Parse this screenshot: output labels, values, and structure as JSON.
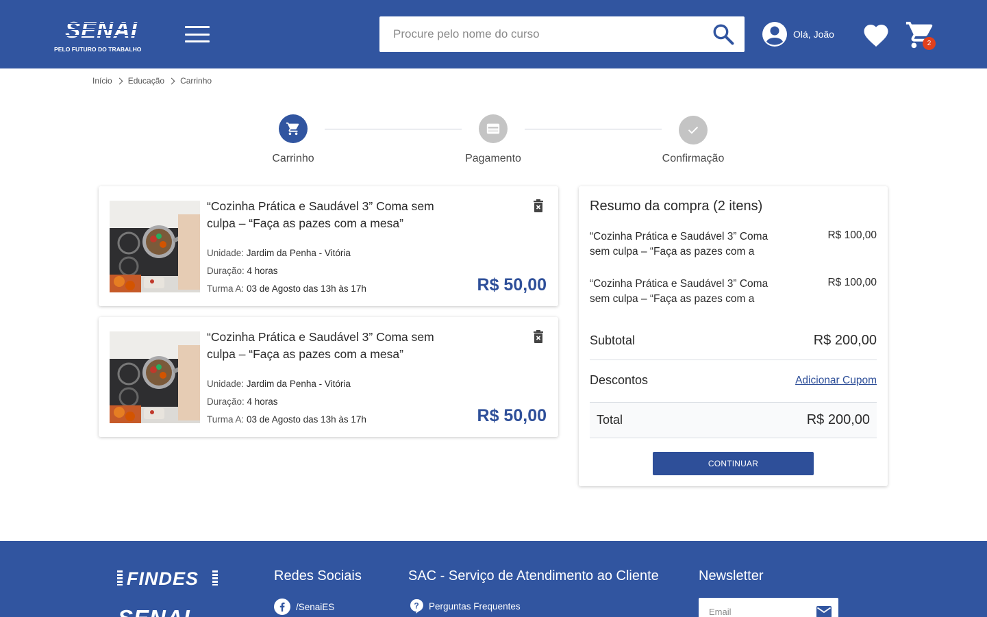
{
  "header": {
    "logo_text": "SENAI",
    "logo_tagline": "PELO FUTURO DO TRABALHO",
    "search_placeholder": "Procure pelo nome do curso",
    "user_greeting": "Olá, João",
    "cart_count": "2"
  },
  "breadcrumb": [
    "Início",
    "Educação",
    "Carrinho"
  ],
  "steps": [
    {
      "label": "Carrinho",
      "state": "active",
      "icon": "cart-icon"
    },
    {
      "label": "Pagamento",
      "state": "pending",
      "icon": "credit-card-icon"
    },
    {
      "label": "Confirmação",
      "state": "pending",
      "icon": "check-icon"
    }
  ],
  "cart_items": [
    {
      "title": "“Cozinha Prática e Saudável 3” Coma sem culpa – “Faça as pazes com a mesa”",
      "unit_label": "Unidade: ",
      "unit_value": "Jardim da Penha - Vitória",
      "duration_label": "Duração: ",
      "duration_value": "4 horas",
      "class_label": "Turma A: ",
      "class_value": "03 de Agosto das 13h às 17h",
      "price": "R$ 50,00"
    },
    {
      "title": "“Cozinha Prática e Saudável 3” Coma sem culpa – “Faça as pazes com a mesa”",
      "unit_label": "Unidade: ",
      "unit_value": "Jardim da Penha - Vitória",
      "duration_label": "Duração: ",
      "duration_value": "4 horas",
      "class_label": "Turma A: ",
      "class_value": "03 de Agosto das 13h às 17h",
      "price": "R$ 50,00"
    }
  ],
  "summary": {
    "title": "Resumo da compra (2 itens)",
    "items": [
      {
        "name": "“Cozinha Prática e Saudável 3” Coma sem culpa – “Faça as pazes com a",
        "value": "R$ 100,00"
      },
      {
        "name": "“Cozinha Prática e Saudável 3” Coma sem culpa – “Faça as pazes com a",
        "value": "R$ 100,00"
      }
    ],
    "subtotal_label": "Subtotal",
    "subtotal_value": "R$ 200,00",
    "discount_label": "Descontos",
    "coupon_link": "Adicionar Cupom",
    "total_label": "Total",
    "total_value": "R$ 200,00",
    "continue_button": "CONTINUAR"
  },
  "footer": {
    "findes_logo": "FINDES",
    "senai_logo": "SENAI",
    "social_heading": "Redes Sociais",
    "social_link": "/SenaiES",
    "sac_heading": "SAC - Serviço de Atendimento ao Cliente",
    "faq_link": "Perguntas Frequentes",
    "newsletter_heading": "Newsletter",
    "email_placeholder": "Email"
  },
  "colors": {
    "brand_blue": "#3155a0",
    "price_blue": "#2e4f99",
    "badge_red": "#e2401c",
    "step_inactive": "#c4c4c4"
  }
}
